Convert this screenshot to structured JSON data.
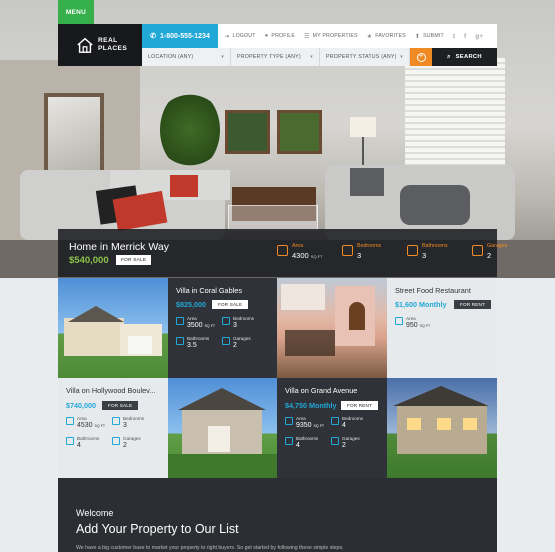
{
  "menu": {
    "label": "MENU"
  },
  "header": {
    "logo_line1": "REAL",
    "logo_line2": "PLACES",
    "phone": "1-800-555-1234",
    "links": [
      {
        "label": "LOGOUT",
        "icon": "logout-icon"
      },
      {
        "label": "PROFILE",
        "icon": "user-icon"
      },
      {
        "label": "MY PROPERTIES",
        "icon": "list-icon"
      },
      {
        "label": "FAVORITES",
        "icon": "star-icon"
      },
      {
        "label": "SUBMIT",
        "icon": "submit-icon"
      }
    ],
    "social": [
      "twitter-icon",
      "facebook-icon",
      "google-plus-icon"
    ]
  },
  "search": {
    "location": "LOCATION (ANY)",
    "type": "PROPERTY TYPE (ANY)",
    "status": "PROPERTY STATUS (ANY)",
    "button": "SEARCH"
  },
  "hero": {
    "title": "Home in Merrick Way",
    "price": "$540,000",
    "badge": "FOR SALE",
    "stats": [
      {
        "label": "Area",
        "value": "4300",
        "unit": "SQ FT"
      },
      {
        "label": "Bedrooms",
        "value": "3",
        "unit": ""
      },
      {
        "label": "Bathrooms",
        "value": "3",
        "unit": ""
      },
      {
        "label": "Garages",
        "value": "2",
        "unit": ""
      }
    ]
  },
  "cards": [
    {
      "title": "Villa in Coral Gables",
      "price": "$825,000",
      "badge": "FOR SALE",
      "area": "3500",
      "area_unit": "SQ FT",
      "bedrooms": "3",
      "bathrooms": "3.5",
      "garages": "2"
    },
    {
      "title": "Street Food Restaurant",
      "price": "$1,600 Monthly",
      "badge": "FOR RENT",
      "area": "950",
      "area_unit": "SQ FT"
    },
    {
      "title": "Villa on Hollywood Boulev...",
      "price": "$740,000",
      "badge": "FOR SALE",
      "area": "4530",
      "area_unit": "SQ FT",
      "bedrooms": "3",
      "bathrooms": "4",
      "garages": "2"
    },
    {
      "title": "Villa on Grand Avenue",
      "price": "$4,750 Monthly",
      "badge": "FOR RENT",
      "area": "9350",
      "area_unit": "SQ FT",
      "bedrooms": "4",
      "bathrooms": "4",
      "garages": "2"
    }
  ],
  "labels": {
    "area": "Area",
    "bedrooms": "Bedrooms",
    "bathrooms": "Bathrooms",
    "garages": "Garages"
  },
  "welcome": {
    "subtitle": "Welcome",
    "title": "Add Your Property to Our List",
    "text": "We have a big customer base to market your property to right buyers. So get started by following these simple steps."
  },
  "colors": {
    "accent": "#22a8d6",
    "orange": "#f08a24",
    "green": "#36b04a",
    "price_green": "#8bc34a"
  }
}
